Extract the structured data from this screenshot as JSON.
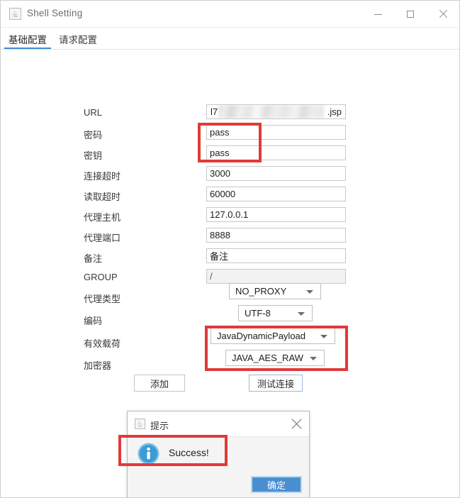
{
  "window": {
    "title": "Shell Setting",
    "icon": "java-cup-icon",
    "controls": {
      "minimize": "minimize-icon",
      "maximize": "maximize-icon",
      "close": "close-icon"
    }
  },
  "tabs": [
    {
      "label": "基础配置",
      "active": true
    },
    {
      "label": "请求配置",
      "active": false
    }
  ],
  "form": {
    "fields": [
      {
        "label": "URL",
        "value_prefix": "l7",
        "value_suffix": ".jsp",
        "redacted": true
      },
      {
        "label": "密码",
        "value": "pass"
      },
      {
        "label": "密钥",
        "value": "pass"
      },
      {
        "label": "连接超时",
        "value": "3000"
      },
      {
        "label": "读取超时",
        "value": "60000"
      },
      {
        "label": "代理主机",
        "value": "127.0.0.1"
      },
      {
        "label": "代理端口",
        "value": "8888"
      },
      {
        "label": "备注",
        "value": "备注"
      },
      {
        "label": "GROUP",
        "value": "/",
        "disabled": true
      }
    ],
    "selects": [
      {
        "label": "代理类型",
        "value": "NO_PROXY"
      },
      {
        "label": "编码",
        "value": "UTF-8"
      },
      {
        "label": "有效载荷",
        "value": "JavaDynamicPayload"
      },
      {
        "label": "加密器",
        "value": "JAVA_AES_RAW"
      }
    ],
    "buttons": {
      "add": "添加",
      "test": "测试连接"
    }
  },
  "annotations": {
    "color": "#e03a3a",
    "boxes": [
      "password-and-key-fields",
      "payload-and-encryptor-selects",
      "success-message"
    ]
  },
  "dialog": {
    "icon": "java-cup-icon",
    "title": "提示",
    "close": "close-icon",
    "message_icon": "info-icon",
    "message": "Success!",
    "ok_label": "确定"
  },
  "colors": {
    "accent": "#3f8ad6",
    "annotation": "#e03a3a",
    "dialog_button": "#4a8fd0",
    "info_icon": "#3d9bd4"
  }
}
